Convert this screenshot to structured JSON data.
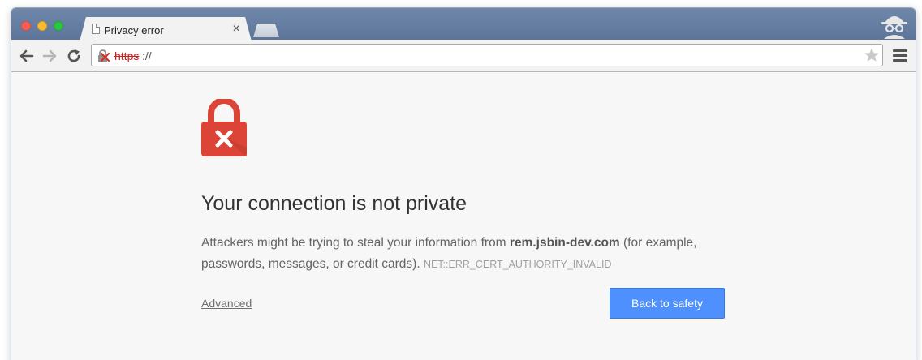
{
  "window": {
    "tab": {
      "title": "Privacy error",
      "close_glyph": "×"
    },
    "incognito_icon": "incognito-icon"
  },
  "toolbar": {
    "back_icon": "back-arrow-icon",
    "forward_icon": "forward-arrow-icon",
    "reload_icon": "reload-icon",
    "url_scheme": "https",
    "url_rest": "://",
    "star_icon": "star-icon",
    "menu_icon": "menu-icon"
  },
  "colors": {
    "titlebar": "#5a7397",
    "lock_red": "#db4437",
    "scheme_red": "#c5221f",
    "button_blue": "#4d90fe"
  },
  "error_page": {
    "lock_icon": "broken-lock-icon",
    "heading": "Your connection is not private",
    "message_part1": "Attackers might be trying to steal your information from ",
    "domain": "rem.jsbin-dev.com",
    "message_part2": " (for example, passwords, messages, or credit cards). ",
    "error_code": "NET::ERR_CERT_AUTHORITY_INVALID",
    "advanced_label": "Advanced",
    "back_button_label": "Back to safety"
  }
}
